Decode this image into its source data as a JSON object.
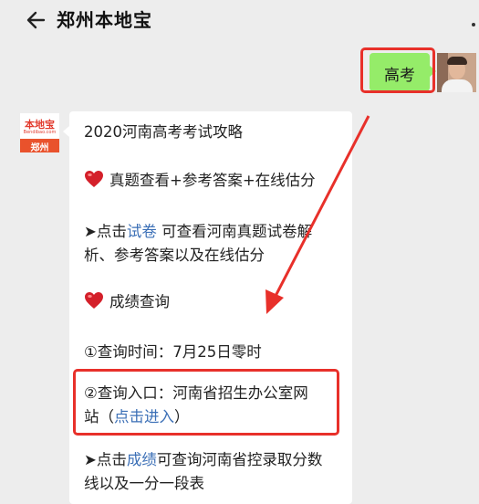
{
  "header": {
    "title": "郑州本地宝",
    "back_icon": "arrow-left-icon",
    "more_icon": "more-icon"
  },
  "my_message": {
    "text": "高考"
  },
  "bot": {
    "avatar_logo": "本地宝",
    "avatar_sub": "Bendibao.com",
    "avatar_city": "郑州"
  },
  "card": {
    "title": "2020河南高考考试攻略",
    "section1": "真题查看+参考答案+在线估分",
    "line3_prefix": "➤点击",
    "line3_link": "试卷",
    "line3_suffix": " 可查看河南真题试卷解",
    "line4": "析、参考答案以及在线估分",
    "section2": "成绩查询",
    "time_line": "①查询时间：7月25日零时",
    "entry_line1": "②查询入口：河南省招生办公室网",
    "entry_line2_prefix": "站（",
    "entry_link": "点击进入",
    "entry_line2_suffix": "）",
    "score_prefix": "➤点击",
    "score_link": "成绩",
    "score_suffix": "可查询河南省控录取分数",
    "score_line2": "线以及一分一段表"
  },
  "colors": {
    "accent_red": "#e8302a",
    "bubble_green": "#95ec69",
    "link_blue": "#3b6fb6",
    "background": "#ededed"
  }
}
